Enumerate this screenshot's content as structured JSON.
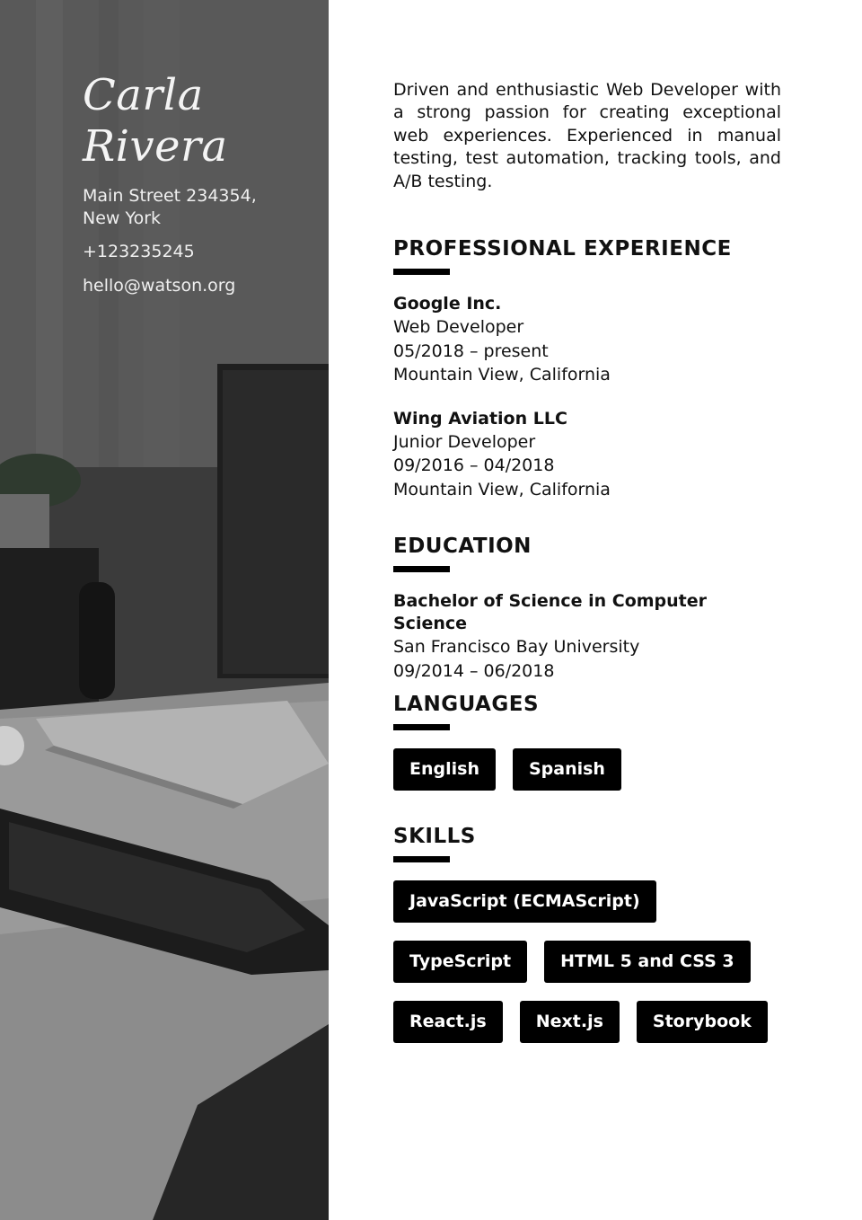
{
  "profile": {
    "first_name": "Carla",
    "last_name": "Rivera",
    "address_line1": "Main Street 234354,",
    "address_line2": "New York",
    "phone": "+123235245",
    "email": "hello@watson.org"
  },
  "summary": "Driven and enthusiastic Web Developer with a strong passion for creating exceptional web experiences. Experienced in manual testing, test automation, tracking tools, and A/B testing.",
  "experience": {
    "title": "PROFESSIONAL EXPERIENCE",
    "jobs": [
      {
        "company": "Google Inc.",
        "role": "Web Developer",
        "dates": "05/2018 – present",
        "location": "Mountain View, California"
      },
      {
        "company": "Wing Aviation LLC",
        "role": "Junior Developer",
        "dates": "09/2016 – 04/2018",
        "location": "Mountain View, California"
      }
    ]
  },
  "education": {
    "title": "EDUCATION",
    "degree": "Bachelor of Science in Computer Science",
    "school": "San Francisco Bay University",
    "dates": "09/2014 – 06/2018"
  },
  "languages": {
    "title": "LANGUAGES",
    "items": [
      "English",
      "Spanish"
    ]
  },
  "skills": {
    "title": "SKILLS",
    "rows": [
      [
        "JavaScript (ECMAScript)"
      ],
      [
        "TypeScript",
        "HTML 5 and CSS 3"
      ],
      [
        "React.js",
        "Next.js",
        "Storybook"
      ]
    ]
  },
  "colors": {
    "accent": "#000000",
    "sidebar_overlay": "#4a4a4a",
    "sidebar_text": "#f2f2f2"
  }
}
